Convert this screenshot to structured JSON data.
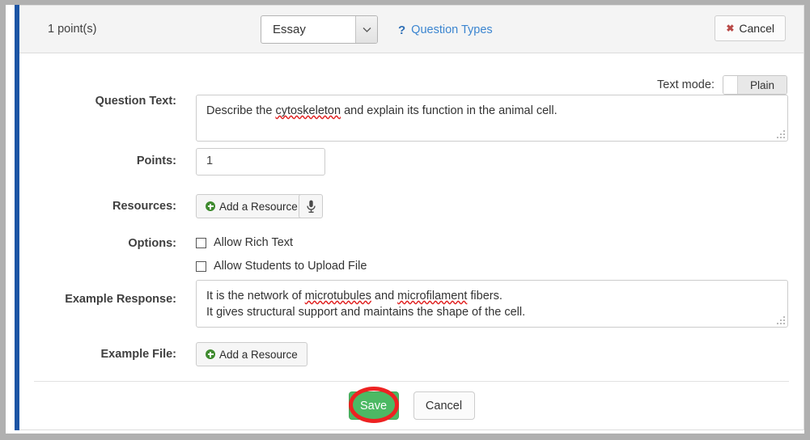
{
  "header": {
    "points_text": "1 point(s)",
    "question_type": "Essay",
    "question_types_link": "Question Types",
    "cancel_label": "Cancel",
    "cancel_icon": "x-mark-icon",
    "help_icon": "question-mark-icon",
    "dropdown_icon": "chevron-down-icon"
  },
  "form": {
    "text_mode_label": "Text mode:",
    "text_mode_value": "Plain",
    "question_text_label": "Question Text:",
    "question_text_value": "Describe the cytoskeleton and explain its function in the animal cell.",
    "question_text_parts": {
      "before": "Describe the ",
      "misspelled": "cytoskeleton",
      "after": " and explain its function in the animal cell."
    },
    "points_label": "Points:",
    "points_value": "1",
    "resources_label": "Resources:",
    "add_resource_label": "Add a Resource",
    "add_resource_icon": "plus-circle-icon",
    "mic_icon": "microphone-icon",
    "options_label": "Options:",
    "options": [
      {
        "label": "Allow Rich Text",
        "checked": false
      },
      {
        "label": "Allow Students to Upload File",
        "checked": false
      }
    ],
    "example_response_label": "Example Response:",
    "example_response_line1_parts": {
      "before": "It is the network of ",
      "misspelled1": "microtubules",
      "middle": " and ",
      "misspelled2": "microfilament",
      "after": " fibers."
    },
    "example_response_line2": "It gives structural support and maintains the shape of the cell.",
    "example_file_label": "Example File:",
    "example_file_button": "Add a Resource"
  },
  "footer": {
    "save_label": "Save",
    "cancel_label": "Cancel"
  },
  "colors": {
    "accent_bar": "#1c55a5",
    "link": "#3b85d0",
    "save_green": "#4cb964",
    "plus_green": "#3e8a2e",
    "cancel_x_red": "#b94a48",
    "annotation_red": "#ee2222",
    "spellcheck_red": "#e02020"
  }
}
